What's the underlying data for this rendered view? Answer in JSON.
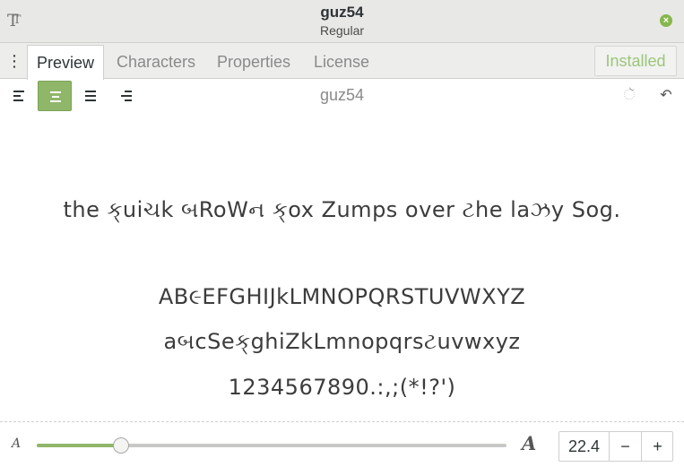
{
  "window": {
    "title": "guz54",
    "subtitle": "Regular",
    "app_icon": "font-viewer-icon",
    "close_icon": "close-icon"
  },
  "tabs": [
    {
      "label": "Preview",
      "active": true
    },
    {
      "label": "Characters",
      "active": false
    },
    {
      "label": "Properties",
      "active": false
    },
    {
      "label": "License",
      "active": false
    }
  ],
  "installed_button": {
    "label": "Installed",
    "color": "#9cc67a"
  },
  "toolbar": {
    "font_name": "guz54",
    "alignment_options": [
      "align-left",
      "align-center",
      "justify",
      "align-right"
    ],
    "active_alignment": "align-center"
  },
  "preview": {
    "sample_sentence": "the ક્uiચk બRoWન ક્ox Zumps over ટhe laઝy Sog.",
    "uppercase": "AB૯EFGHIJkLMNOPQRSTUVWXYZ",
    "lowercase": "aબcSeક્ghiZkLmnopqrsટuvwxyz",
    "digits_punct": "1234567890.:,;(*!?')"
  },
  "footer": {
    "size_value": "22.4",
    "slider_fraction": 0.18,
    "minus_label": "−",
    "plus_label": "+",
    "accent": "#8fb669"
  }
}
